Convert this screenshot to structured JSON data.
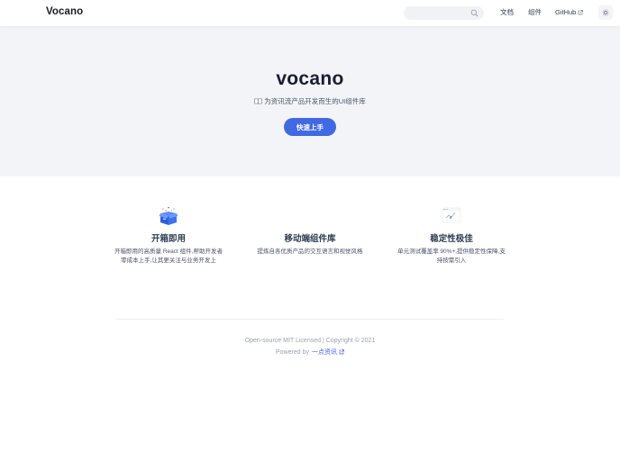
{
  "navbar": {
    "brand": "Vocano",
    "search_placeholder": "",
    "links": {
      "docs": "文档",
      "components": "组件",
      "github": "GitHub"
    }
  },
  "hero": {
    "title": "vocano",
    "subtitle": "为资讯流产品开发而生的UI组件库",
    "cta_label": "快速上手"
  },
  "features": [
    {
      "title": "开箱即用",
      "description": "开箱即用的高质量 React 组件,帮助开发者零成本上手,让其更关注与业务开发上",
      "icon": "box-icon"
    },
    {
      "title": "移动端组件库",
      "description": "提炼自各优质产品的交互语言和视觉风格",
      "icon": "mobile-icon"
    },
    {
      "title": "稳定性极佳",
      "description": "单元测试覆盖率 90%+,提供稳定性保障,支持按需引入",
      "icon": "chart-card-icon"
    }
  ],
  "footer": {
    "license": "Open-source MIT Licensed | Copyright © 2021",
    "powered_prefix": "Powered by",
    "powered_link": "一点资讯"
  },
  "colors": {
    "accent": "#4169e1",
    "hero_bg": "#f3f4f7",
    "text": "#2c3e50"
  }
}
